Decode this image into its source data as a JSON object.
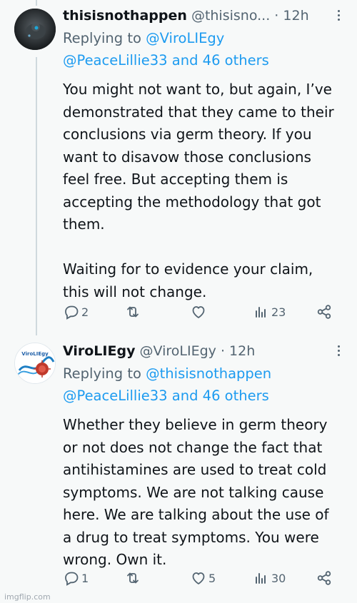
{
  "tweets": [
    {
      "display_name": "thisisnothappen",
      "handle": "@thisisno...",
      "dot": "·",
      "time": "12h",
      "reply_prefix": "Replying to",
      "reply_to_1": "@ViroLIEgy",
      "reply_to_2": "@PeaceLillie33 and 46 others",
      "text": "You might not want to, but again, I’ve demonstrated that they came to their conclusions via germ theory. If you want to disavow those conclusions feel free. But accepting them is accepting the methodology that got them.\n\nWaiting for to evidence your claim, this will not change.",
      "replies": "2",
      "retweets": "",
      "likes": "",
      "views": "23",
      "avatar_icon": "dark-avatar-icon"
    },
    {
      "display_name": "ViroLIEgy",
      "handle": "@ViroLIEgy",
      "dot": "·",
      "time": "12h",
      "reply_prefix": "Replying to",
      "reply_to_1": "@thisisnothappen",
      "reply_to_2": "@PeaceLillie33 and 46 others",
      "text": "Whether they believe in germ theory or not does not change the fact that antihistamines are used to treat cold symptoms. We are not talking cause here. We are talking about the use of a drug to treat symptoms. You were wrong. Own it.",
      "replies": "1",
      "retweets": "",
      "likes": "5",
      "views": "30",
      "avatar_label": "ViroLIEgy",
      "avatar_icon": "virus-avatar-icon"
    }
  ],
  "watermark": "imgflip.com",
  "colors": {
    "background": "#f7f9f9",
    "link": "#1d9bf0",
    "secondary": "#536471",
    "text": "#0f1419",
    "thread_line": "#cfd9de"
  }
}
